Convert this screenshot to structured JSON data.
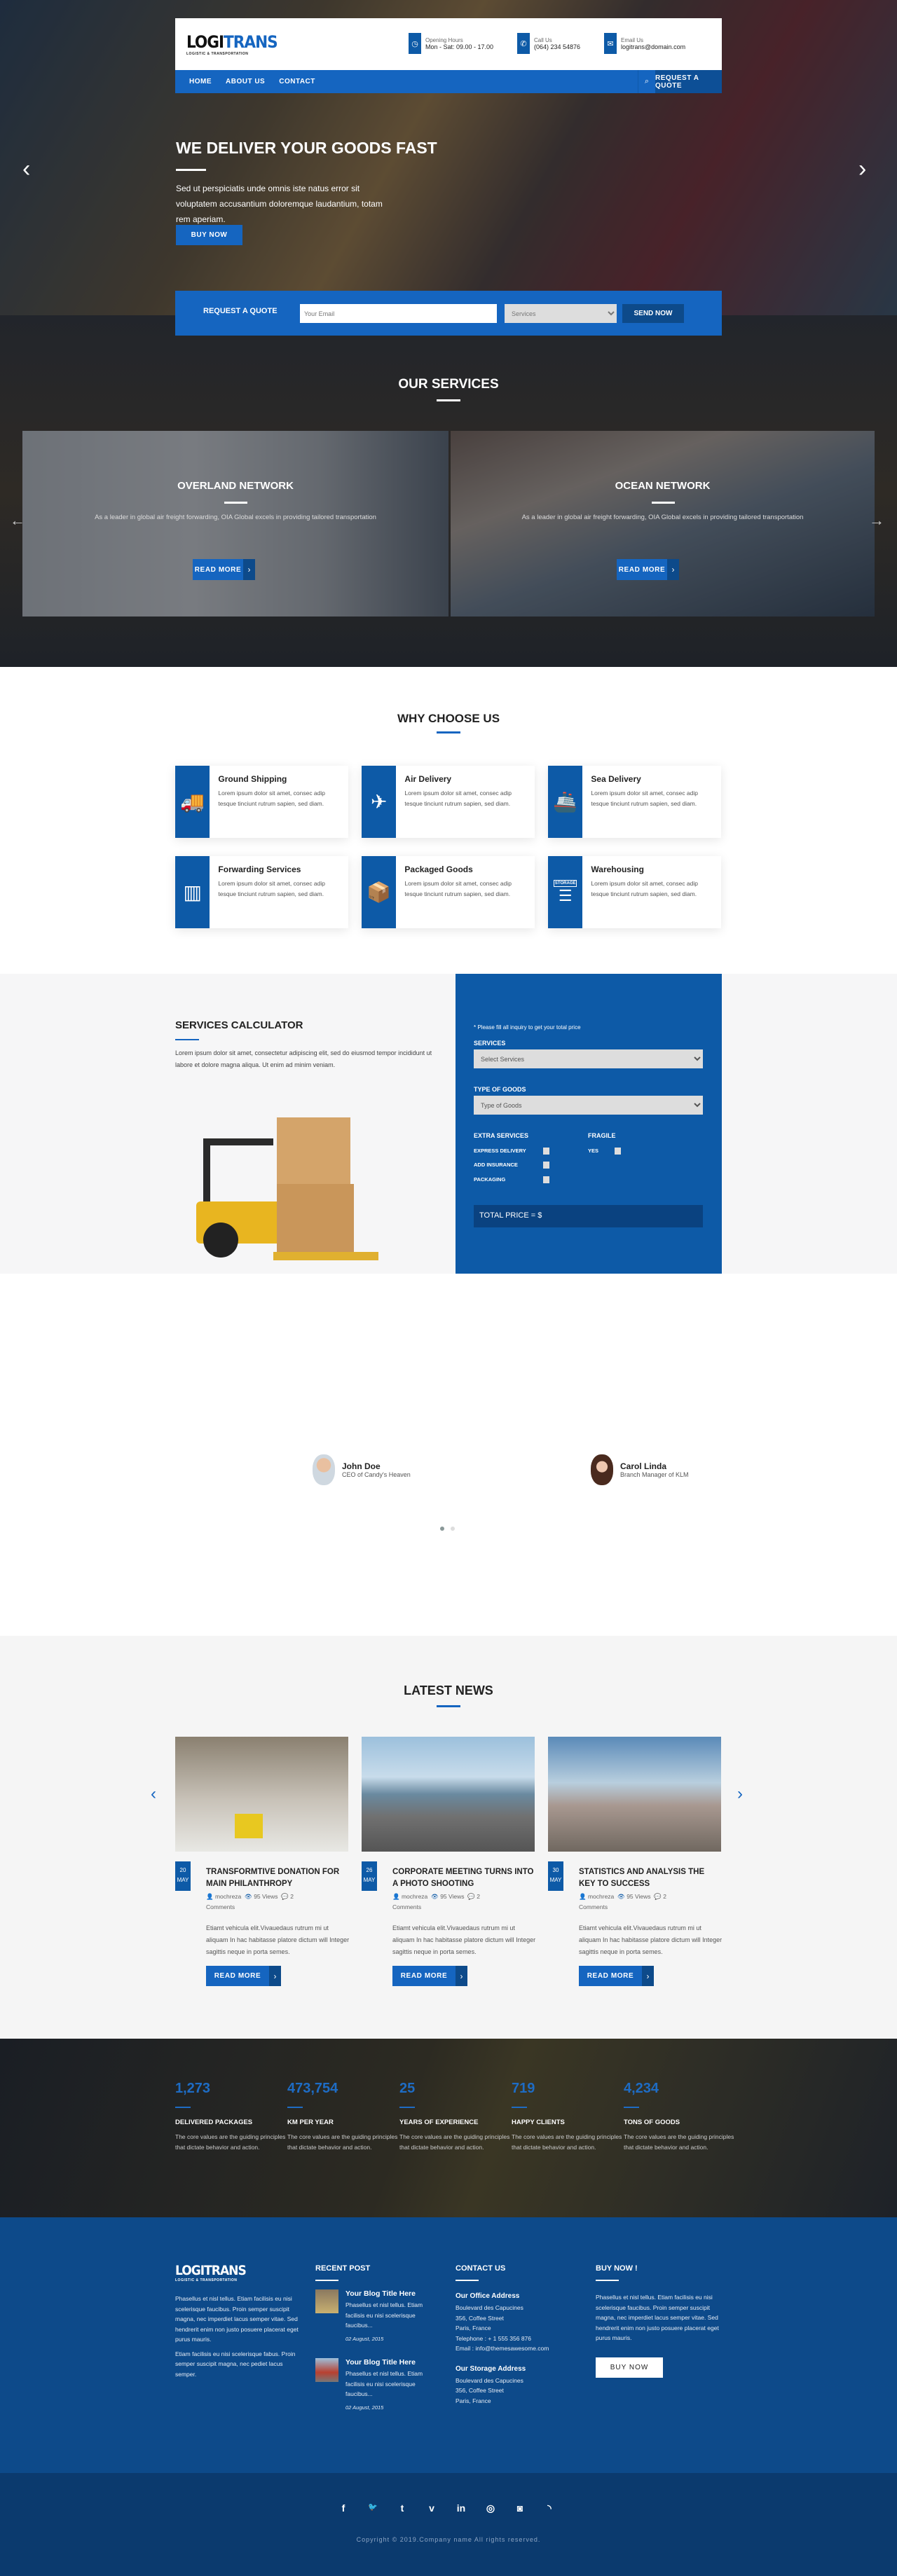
{
  "brand": {
    "name_a": "LOGI",
    "name_b": "TRANS",
    "tagline": "LOGISTIC & TRANSPORTATION"
  },
  "header": {
    "info": [
      {
        "icon": "clock-icon",
        "label": "Opening Hours",
        "value": "Mon - Sat: 09.00 - 17.00"
      },
      {
        "icon": "phone-icon",
        "label": "Call Us",
        "value": "(064) 234 54876"
      },
      {
        "icon": "envelope-icon",
        "label": "Email Us",
        "value": "logitrans@domain.com"
      }
    ],
    "nav": [
      "HOME",
      "ABOUT US",
      "CONTACT"
    ],
    "search_icon": "search-icon",
    "quote_button": "REQUEST A QUOTE"
  },
  "hero": {
    "title": "WE DELIVER YOUR GOODS FAST",
    "text": "Sed ut perspiciatis unde omnis iste natus error sit voluptatem accusantium doloremque laudantium, totam rem aperiam.",
    "button": "BUY NOW"
  },
  "quote": {
    "label": "REQUEST A QUOTE",
    "email_placeholder": "Your Email",
    "services_value": "Services",
    "send": "SEND NOW"
  },
  "services": {
    "title": "OUR SERVICES",
    "slides": [
      {
        "title": "OVERLAND NETWORK",
        "text": "As a leader in global air freight forwarding, OIA Global excels in providing tailored transportation",
        "button": "READ MORE"
      },
      {
        "title": "OCEAN NETWORK",
        "text": "As a leader in global air freight forwarding, OIA Global excels in providing tailored transportation",
        "button": "READ MORE"
      }
    ]
  },
  "why": {
    "title": "WHY CHOOSE US",
    "cards": [
      {
        "icon": "truck-icon",
        "title": "Ground Shipping",
        "text": "Lorem ipsum dolor sit amet, consec adip tesque tinciunt rutrum sapien, sed diam."
      },
      {
        "icon": "airplane-icon",
        "title": "Air Delivery",
        "text": "Lorem ipsum dolor sit amet, consec adip tesque tinciunt rutrum sapien, sed diam."
      },
      {
        "icon": "ship-icon",
        "title": "Sea Delivery",
        "text": "Lorem ipsum dolor sit amet, consec adip tesque tinciunt rutrum sapien, sed diam."
      },
      {
        "icon": "crane-container-icon",
        "title": "Forwarding Services",
        "text": "Lorem ipsum dolor sit amet, consec adip tesque tinciunt rutrum sapien, sed diam."
      },
      {
        "icon": "fragile-box-icon",
        "title": "Packaged Goods",
        "text": "Lorem ipsum dolor sit amet, consec adip tesque tinciunt rutrum sapien, sed diam."
      },
      {
        "icon": "storage-icon",
        "title": "Warehousing",
        "text": "Lorem ipsum dolor sit amet, consec adip tesque tinciunt rutrum sapien, sed diam.",
        "badge": "STORAGE"
      }
    ]
  },
  "calculator": {
    "title": "SERVICES CALCULATOR",
    "text": "Lorem ipsum dolor sit amet, consectetur adipiscing elit, sed do eiusmod tempor incididunt ut labore et dolore magna aliqua. Ut enim ad minim veniam.",
    "note": "* Please fill all inquiry to get your total price",
    "services_label": "SERVICES",
    "services_value": "Select Services",
    "goods_label": "TYPE OF GOODS",
    "goods_value": "Type of Goods",
    "extra_label": "EXTRA SERVICES",
    "extras": [
      "EXPRESS DELIVERY",
      "ADD INSURANCE",
      "PACKAGING"
    ],
    "fragile_label": "FRAGILE",
    "fragile_option": "YES",
    "total": "TOTAL PRICE = $"
  },
  "testimonials": {
    "people": [
      {
        "name": "John Doe",
        "role": "CEO of Candy's Heaven"
      },
      {
        "name": "Carol Linda",
        "role": "Branch Manager of KLM"
      }
    ],
    "active_dot": 1,
    "dots": 2
  },
  "news": {
    "title": "LATEST NEWS",
    "posts": [
      {
        "day": "20",
        "month": "MAY",
        "title": "TRANSFORMTIVE DONATION FOR MAIN PHILANTHROPY",
        "author": "mochreza",
        "views": "95 Views",
        "comments": "2 Comments",
        "text": "Etiamt vehicula elit.Vivauedaus rutrum mi ut aliquam In hac habitasse platore dictum will Integer sagittis neque in porta semes.",
        "button": "READ MORE"
      },
      {
        "day": "26",
        "month": "MAY",
        "title": "CORPORATE MEETING TURNS INTO A PHOTO SHOOTING",
        "author": "mochreza",
        "views": "95 Views",
        "comments": "2 Comments",
        "text": "Etiamt vehicula elit.Vivauedaus rutrum mi ut aliquam In hac habitasse platore dictum will Integer sagittis neque in porta semes.",
        "button": "READ MORE"
      },
      {
        "day": "30",
        "month": "MAY",
        "title": "STATISTICS AND ANALYSIS THE KEY TO SUCCESS",
        "author": "mochreza",
        "views": "95 Views",
        "comments": "2 Comments",
        "text": "Etiamt vehicula elit.Vivauedaus rutrum mi ut aliquam In hac habitasse platore dictum will Integer sagittis neque in porta semes.",
        "button": "READ MORE"
      }
    ]
  },
  "counters": [
    {
      "value": "1,273",
      "label": "DELIVERED PACKAGES",
      "text": "The core values are the guiding principles that dictate behavior and action."
    },
    {
      "value": "473,754",
      "label": "KM PER YEAR",
      "text": "The core values are the guiding principles that dictate behavior and action."
    },
    {
      "value": "25",
      "label": "YEARS OF EXPERIENCE",
      "text": "The core values are the guiding principles that dictate behavior and action."
    },
    {
      "value": "719",
      "label": "HAPPY CLIENTS",
      "text": "The core values are the guiding principles that dictate behavior and action."
    },
    {
      "value": "4,234",
      "label": "TONS OF GOODS",
      "text": "The core values are the guiding principles that dictate behavior and action."
    }
  ],
  "footer": {
    "about_p1": "Phasellus et nisl tellus. Etiam facilisis eu nisi scelerisque faucibus. Proin semper suscipit magna, nec imperdiet lacus semper vitae. Sed hendrerit enim non justo posuere placerat eget purus mauris.",
    "about_p2": "Etiam facilisis eu nisi scelerisque fabus. Proin semper suscipit magna, nec pediet lacus semper.",
    "recent_title": "RECENT POST",
    "recent": [
      {
        "title": "Your Blog Title Here",
        "text": "Phasellus et nisl tellus. Etiam facilisis eu nisi scelerisque faucibus...",
        "date": "02 August, 2015"
      },
      {
        "title": "Your Blog Title Here",
        "text": "Phasellus et nisl tellus. Etiam facilisis eu nisi scelerisque faucibus...",
        "date": "02 August, 2015"
      }
    ],
    "contact_title": "CONTACT US",
    "office_title": "Our Office Address",
    "office": [
      "Boulevard des Capucines",
      "356, Coffee Street",
      "Paris, France",
      "Telephone : + 1 555 356 876",
      "Email : info@themesawesome.com"
    ],
    "storage_title": "Our Storage Address",
    "storage": [
      "Boulevard des Capucines",
      "356, Coffee Street",
      "Paris, France"
    ],
    "buy_title": "BUY NOW !",
    "buy_text": "Phasellus et nisl tellus. Etiam facilisis eu nisi scelerisque faucibus. Proin semper suscipit magna, nec imperdiet lacus semper vitae. Sed hendrerit enim non justo posuere placerat eget purus mauris.",
    "buy_button": "BUY NOW"
  },
  "bottom": {
    "social": [
      {
        "icon": "facebook-icon",
        "glyph": "f"
      },
      {
        "icon": "twitter-icon",
        "glyph": "🐦"
      },
      {
        "icon": "tumblr-icon",
        "glyph": "t"
      },
      {
        "icon": "vimeo-icon",
        "glyph": "v"
      },
      {
        "icon": "linkedin-icon",
        "glyph": "in"
      },
      {
        "icon": "dribbble-icon",
        "glyph": "◎"
      },
      {
        "icon": "instagram-icon",
        "glyph": "◙"
      },
      {
        "icon": "rss-icon",
        "glyph": "◝"
      }
    ],
    "copyright": "Copyright © 2019.Company name All rights reserved."
  },
  "colors": {
    "primary": "#1565c0",
    "dark_blue": "#0d4a8a",
    "footer": "#0d4a8a",
    "bottom": "#0b3a6e",
    "counter": "#1e6cc4"
  }
}
